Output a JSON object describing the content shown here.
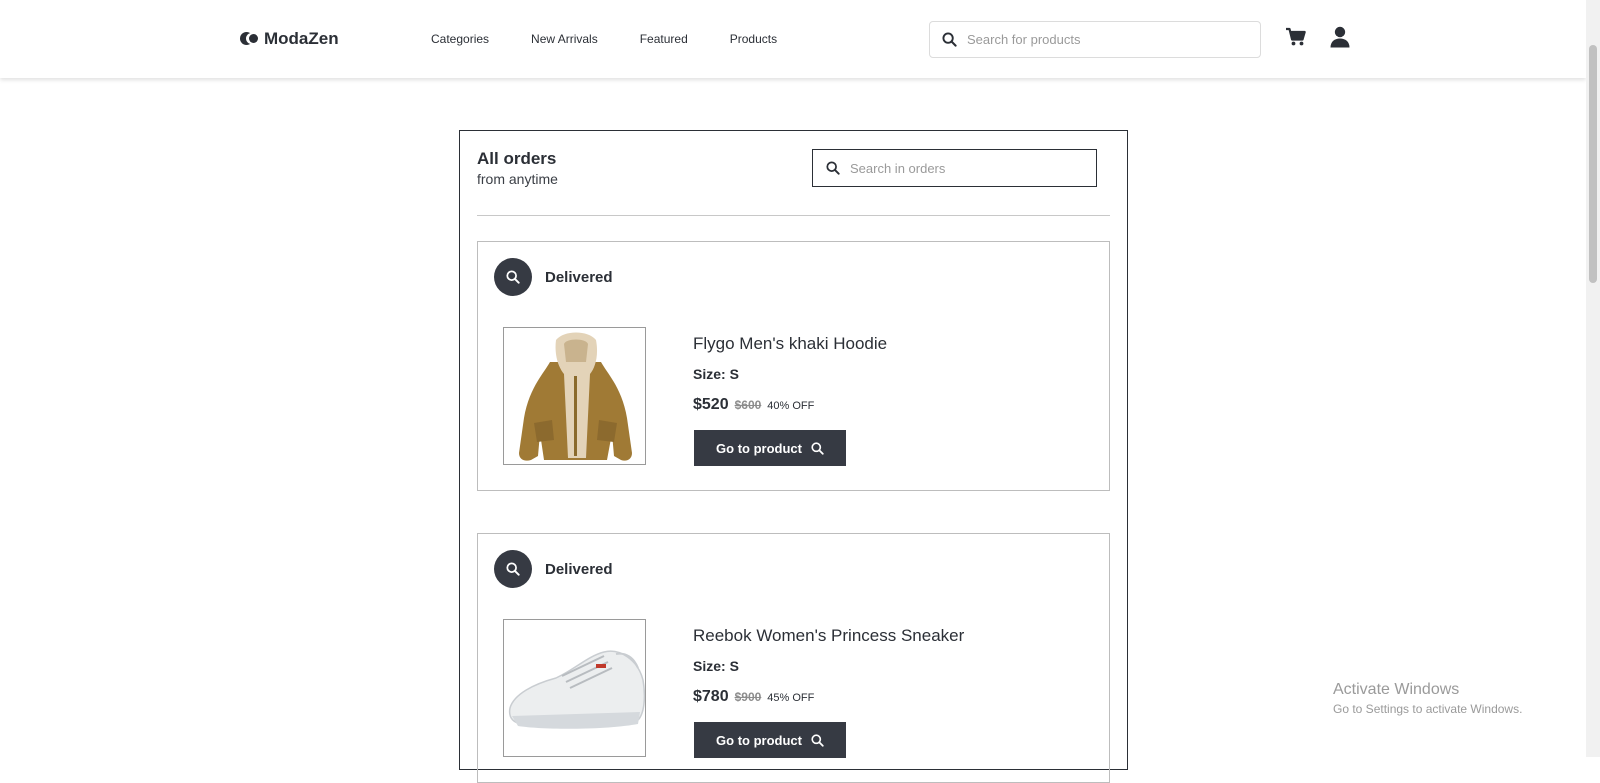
{
  "brand": {
    "name": "ModaZen",
    "logo_icon": "modazen-logo-icon"
  },
  "nav": {
    "links": [
      "Categories",
      "New Arrivals",
      "Featured",
      "Products"
    ]
  },
  "header": {
    "search_placeholder": "Search for products",
    "cart_icon": "cart-icon",
    "user_icon": "user-icon"
  },
  "orders": {
    "title": "All orders",
    "subtitle": "from anytime",
    "search_placeholder": "Search in orders",
    "items": [
      {
        "status": "Delivered",
        "name": "Flygo Men's khaki Hoodie",
        "size": "Size: S",
        "price": "$520",
        "old_price": "$600",
        "discount": "40% OFF",
        "button": "Go to product",
        "image_icon": "hoodie-image"
      },
      {
        "status": "Delivered",
        "name": "Reebok Women's Princess Sneaker",
        "size": "Size: S",
        "price": "$780",
        "old_price": "$900",
        "discount": "45% OFF",
        "button": "Go to product",
        "image_icon": "sneaker-image"
      }
    ]
  },
  "watermark": {
    "title": "Activate Windows",
    "subtitle": "Go to Settings to activate Windows."
  },
  "colors": {
    "dark": "#363a43",
    "text": "#2b2f36",
    "muted": "#8c8c8c"
  }
}
